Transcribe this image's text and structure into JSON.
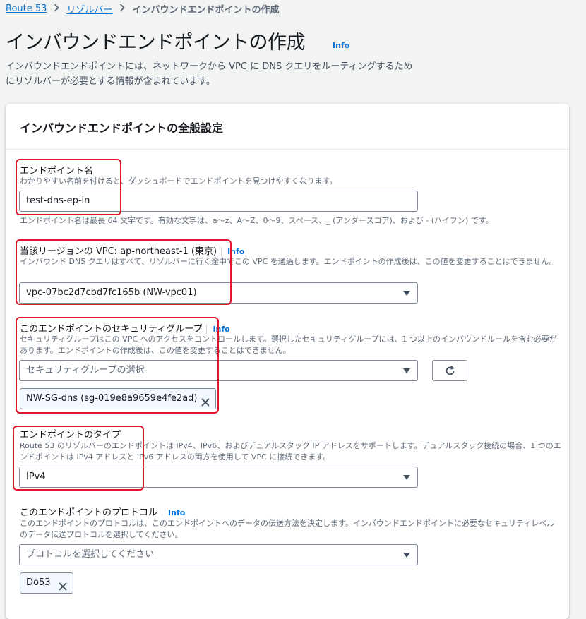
{
  "breadcrumb": {
    "items": [
      "Route 53",
      "リゾルバー"
    ],
    "current": "インバウンドエンドポイントの作成"
  },
  "page": {
    "title": "インバウンドエンドポイントの作成",
    "info": "Info",
    "description": "インバウンドエンドポイントには、ネットワークから VPC に DNS クエリをルーティングするためにリゾルバーが必要とする情報が含まれています。"
  },
  "panel": {
    "title": "インバウンドエンドポイントの全般設定"
  },
  "endpoint_name": {
    "label": "エンドポイント名",
    "description": "わかりやすい名前を付けると、ダッシュボードでエンドポイントを見つけやすくなります。",
    "value": "test-dns-ep-in",
    "constraint": "エンドポイント名は最長 64 文字です。有効な文字は、a～z、A～Z、0～9、スペース、_ (アンダースコア)、および - (ハイフン) です。"
  },
  "vpc": {
    "label": "当該リージョンの VPC: ap-northeast-1 (東京)",
    "info": "Info",
    "description": "インバウンド DNS クエリはすべて、リゾルバーに行く途中でこの VPC を通過します。エンドポイントの作成後は、この値を変更することはできません。",
    "value": "vpc-07bc2d7cbd7fc165b (NW-vpc01)"
  },
  "security_group": {
    "label": "このエンドポイントのセキュリティグループ",
    "info": "Info",
    "description": "セキュリティグループはこの VPC へのアクセスをコントロールします。選択したセキュリティグループには、1 つ以上のインバウンドルールを含む必要があります。エンドポイントの作成後は、この値を変更することはできません。",
    "placeholder": "セキュリティグループの選択",
    "token": "NW-SG-dns (sg-019e8a9659e4fe2ad)"
  },
  "endpoint_type": {
    "label": "エンドポイントのタイプ",
    "description": "Route 53 のリゾルバーのエンドポイントは IPv4、IPv6、およびデュアルスタック IP アドレスをサポートします。デュアルスタック接続の場合、1 つのエンドポイントは IPv4 アドレスと IPv6 アドレスの両方を使用して VPC に接続できます。",
    "value": "IPv4"
  },
  "protocol": {
    "label": "このエンドポイントのプロトコル",
    "info": "Info",
    "description": "このエンドポイントのプロトコルは、このエンドポイントへのデータの伝送方法を決定します。インバウンドエンドポイントに必要なセキュリティレベルのデータ伝送プロトコルを選択してください。",
    "placeholder": "プロトコルを選択してください",
    "token": "Do53"
  },
  "colors": {
    "link": "#0972d3",
    "highlight": "#e0172c",
    "border": "#7d8998",
    "token_bg": "#f2f8fd"
  },
  "icons": {
    "breadcrumb_separator": "chevron-right-icon",
    "dropdown": "caret-down-icon",
    "refresh": "refresh-icon",
    "remove": "close-icon"
  }
}
